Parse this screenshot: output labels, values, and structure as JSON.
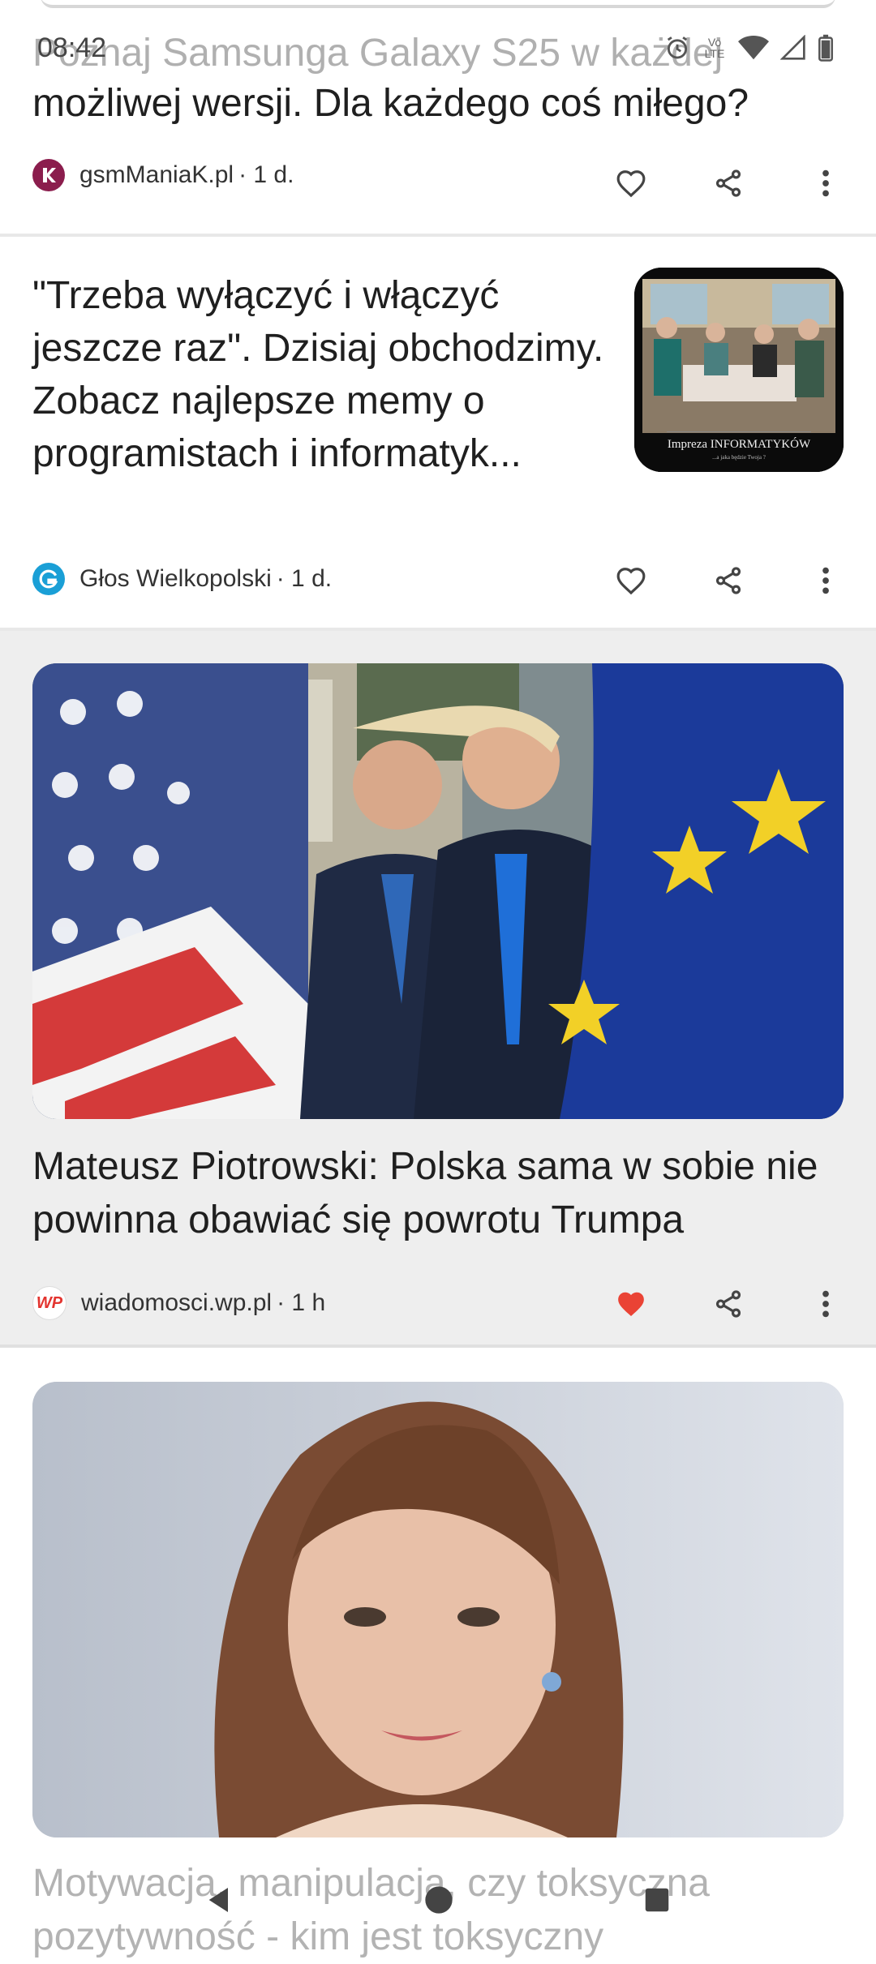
{
  "status_bar": {
    "time": "08:42",
    "lte_label": "Vo LTE",
    "icons": [
      "alarm-icon",
      "volte-icon",
      "wifi-icon",
      "signal-icon",
      "battery-icon"
    ]
  },
  "feed": [
    {
      "title_line1": "Poznaj Samsunga Galaxy S25 w każdej",
      "title_line2": "możliwej wersji. Dla każdego coś miłego?",
      "source": "gsmManiaK.pl",
      "time": "· 1 d.",
      "liked": false
    },
    {
      "title": "\"Trzeba wyłączyć i włączyć jeszcze raz\". Dzisiaj obchodzimy. Zobacz najlepsze memy o programistach i informatyk...",
      "source": "Głos Wielkopolski",
      "time": "· 1 d.",
      "thumbnail_caption": "Impreza INFORMATYKÓW",
      "thumbnail_subcaption": "...a jaka będzie Twoja ?",
      "liked": false
    },
    {
      "title": "Mateusz Piotrowski: Polska sama w sobie nie powinna obawiać się powrotu Trumpa",
      "source": "wiadomosci.wp.pl",
      "time": "· 1 h",
      "liked": true
    },
    {
      "title": "Motywacja, manipulacja, czy toksyczna pozytywność - kim jest toksyczny"
    }
  ],
  "colors": {
    "accent_like": "#ea4335",
    "gsm_logo": "#8b1d4d",
    "glos_logo": "#1a9fd6",
    "wp_logo": "#e3342f"
  },
  "navbar": {
    "icons": [
      "back-icon",
      "home-icon",
      "recents-icon"
    ]
  }
}
